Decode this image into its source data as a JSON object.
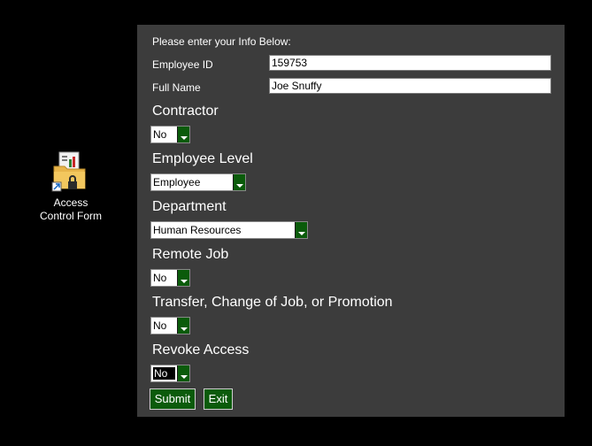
{
  "desktop": {
    "icon_name": "access-form-icon",
    "icon_label_line1": "Access",
    "icon_label_line2": "Control Form"
  },
  "form": {
    "heading": "Please enter your Info Below:",
    "employee_id": {
      "label": "Employee ID",
      "value": "159753"
    },
    "full_name": {
      "label": "Full Name",
      "value": "Joe Snuffy"
    },
    "contractor": {
      "label": "Contractor",
      "value": "No"
    },
    "employee_level": {
      "label": "Employee Level",
      "value": "Employee"
    },
    "department": {
      "label": "Department",
      "value": "Human Resources"
    },
    "remote_job": {
      "label": "Remote Job",
      "value": "No"
    },
    "transfer": {
      "label": "Transfer, Change of Job, or Promotion",
      "value": "No"
    },
    "revoke_access": {
      "label": "Revoke Access",
      "value": "No"
    },
    "submit_label": "Submit",
    "exit_label": "Exit"
  },
  "colors": {
    "panel_bg": "#3c3c3c",
    "accent_green": "#0b5b0b",
    "desktop_bg": "#000000"
  }
}
